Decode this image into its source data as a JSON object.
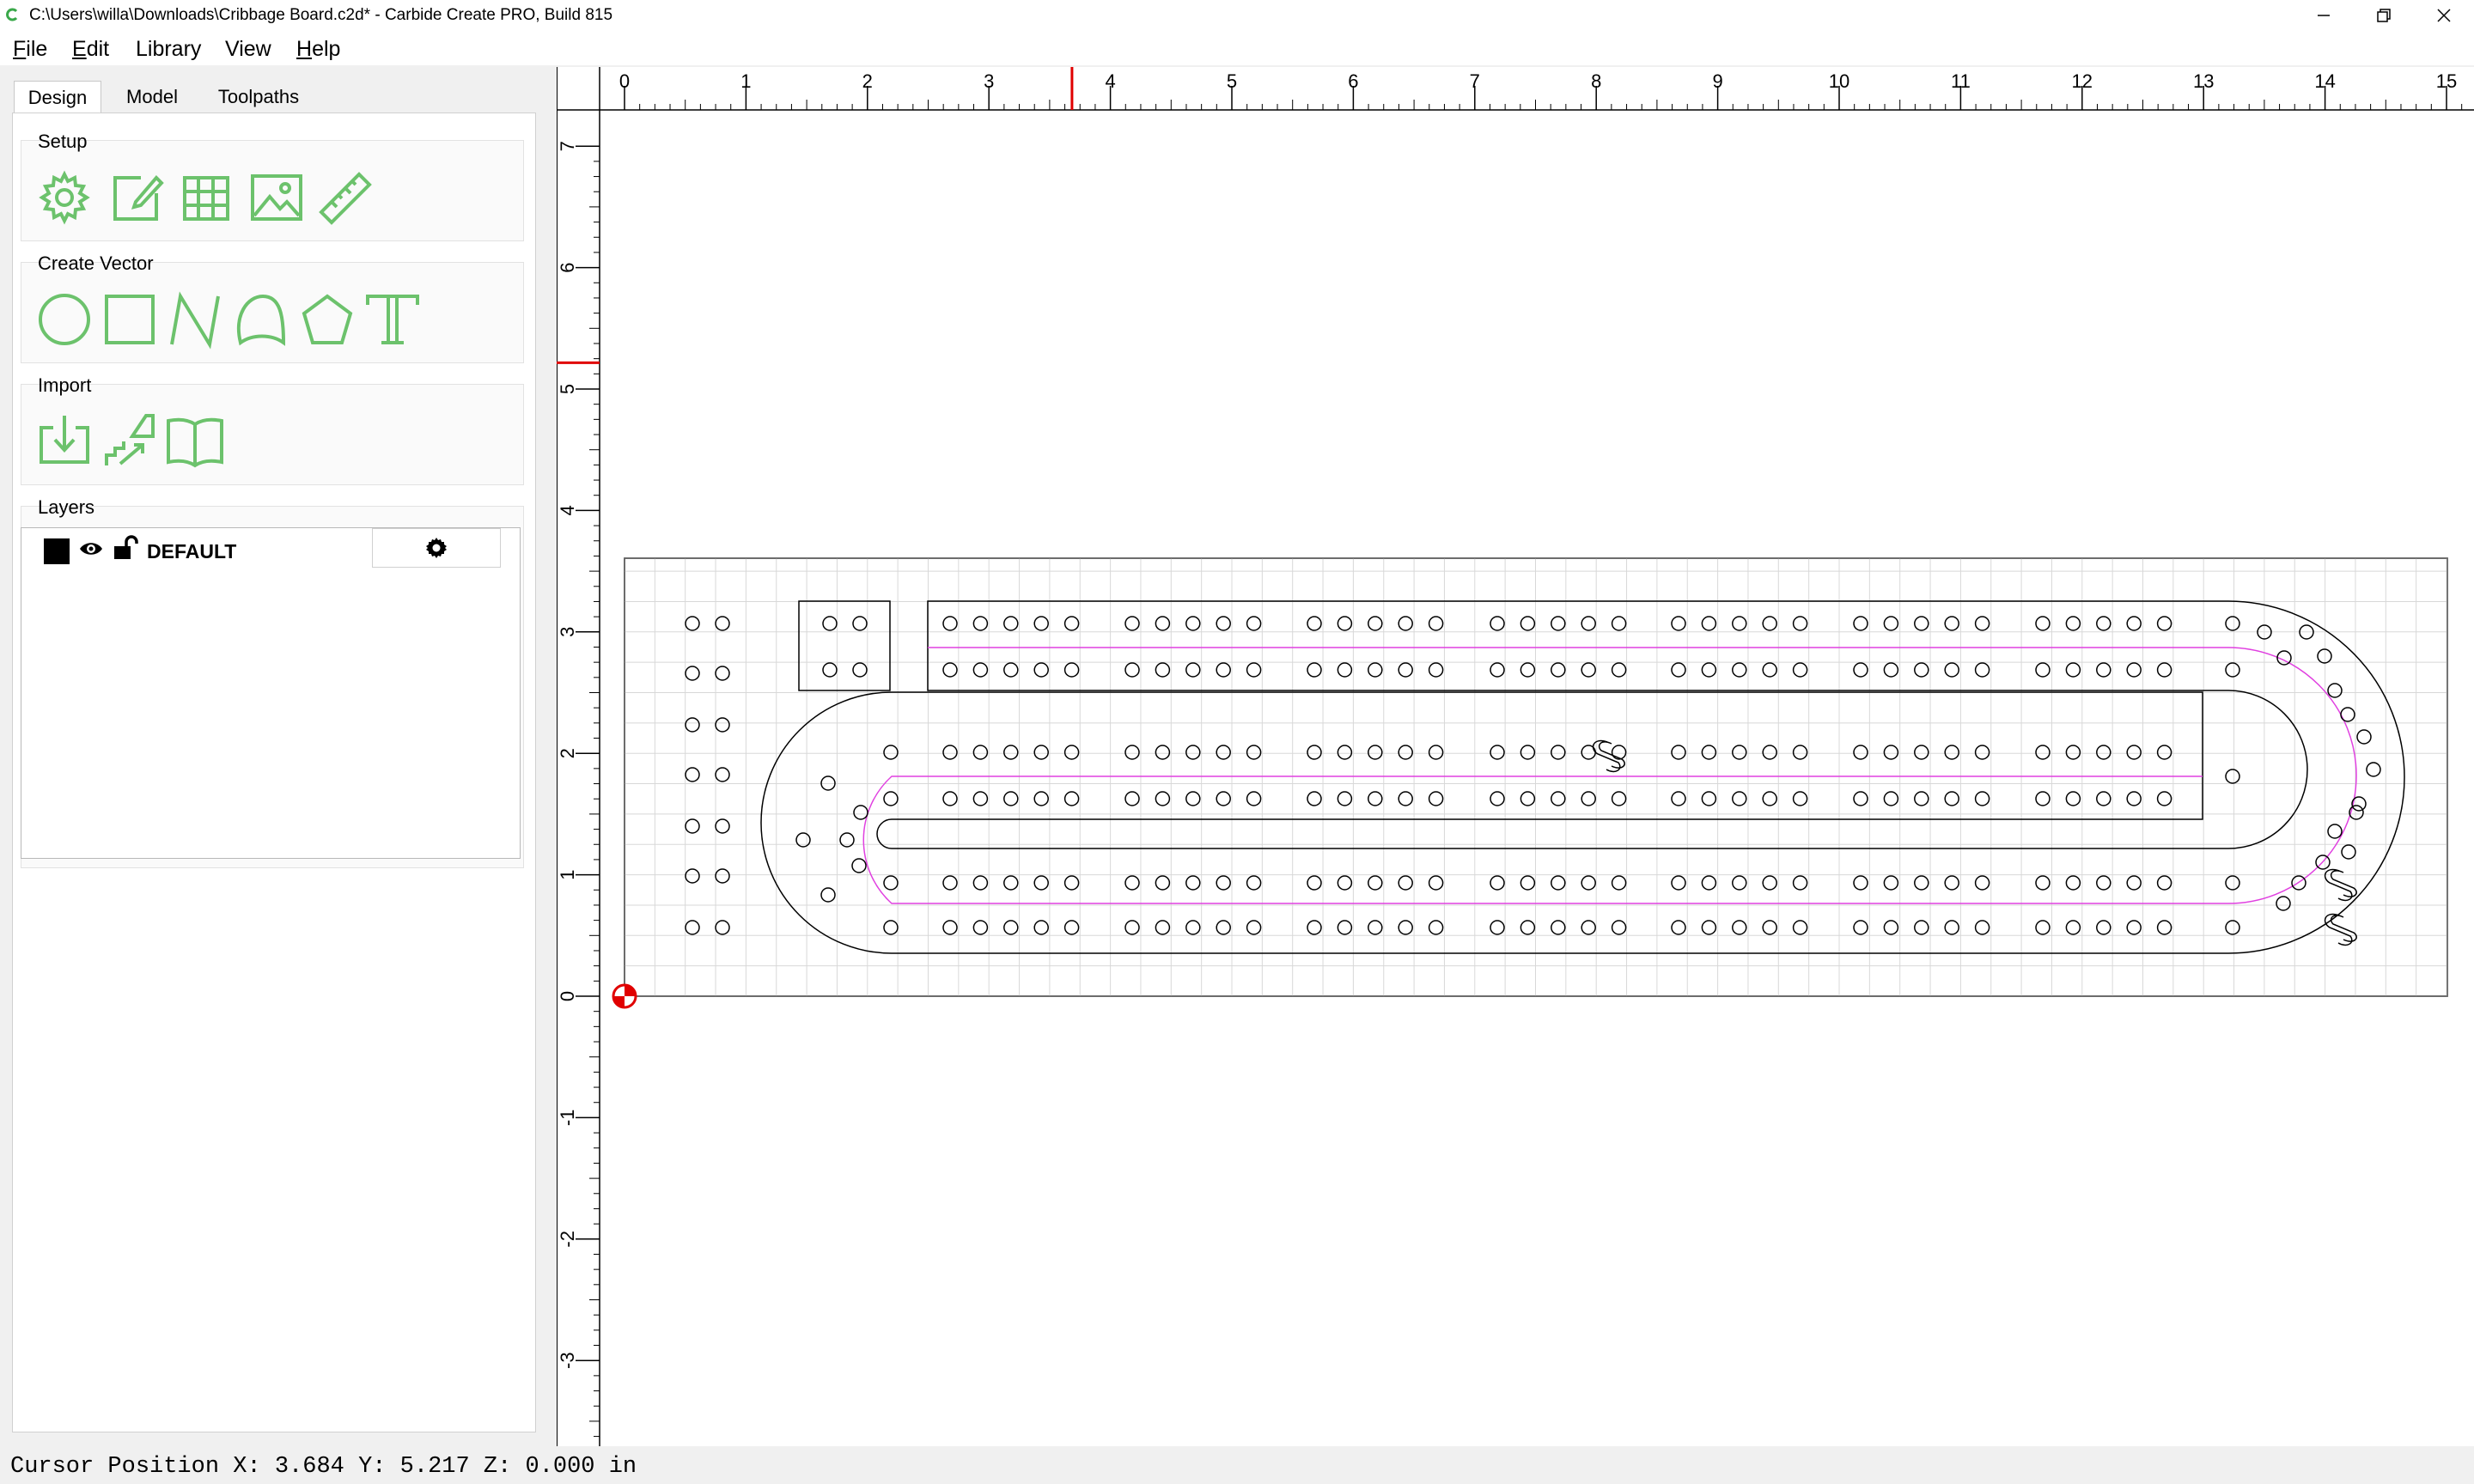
{
  "window": {
    "title": "C:\\Users\\willa\\Downloads\\Cribbage Board.c2d* - Carbide Create PRO, Build 815",
    "app_icon": "carbide-c-icon",
    "controls": [
      "minimize-icon",
      "restore-icon",
      "close-icon"
    ]
  },
  "menu": {
    "items": [
      {
        "label": "File",
        "underline": "F",
        "rest": "ile"
      },
      {
        "label": "Edit",
        "underline": "E",
        "rest": "dit"
      },
      {
        "label": "Library",
        "underline": "",
        "rest": "Library"
      },
      {
        "label": "View",
        "underline": "",
        "rest": "View"
      },
      {
        "label": "Help",
        "underline": "H",
        "rest": "elp"
      }
    ]
  },
  "tabs": [
    {
      "label": "Design",
      "active": true
    },
    {
      "label": "Model",
      "active": false
    },
    {
      "label": "Toolpaths",
      "active": false
    }
  ],
  "groups": {
    "setup": {
      "title": "Setup",
      "tools": [
        "job-setup-gear-icon",
        "edit-note-icon",
        "grid-icon",
        "image-icon",
        "ruler-icon"
      ]
    },
    "create_vector": {
      "title": "Create Vector",
      "tools": [
        "circle-icon",
        "rectangle-icon",
        "polyline-icon",
        "curve-icon",
        "polygon-icon",
        "text-icon"
      ]
    },
    "import": {
      "title": "Import",
      "tools": [
        "import-vector-icon",
        "import-stl-icon",
        "library-book-icon"
      ]
    },
    "layers": {
      "title": "Layers"
    }
  },
  "layers": [
    {
      "name": "DEFAULT",
      "color": "#000000",
      "visible": true,
      "locked": false
    }
  ],
  "ruler": {
    "x_labels": [
      "0",
      "1",
      "2",
      "3",
      "4",
      "5",
      "6",
      "7",
      "8",
      "9",
      "10",
      "11",
      "12",
      "13",
      "14",
      "15"
    ],
    "y_labels": [
      "7",
      "6",
      "5",
      "4",
      "3",
      "2",
      "1",
      "0",
      "-1",
      "-2",
      "-3"
    ]
  },
  "cursor": {
    "x": 3.684,
    "y": 5.217
  },
  "status": {
    "text": "Cursor Position X: 3.684 Y: 5.217 Z: 0.000 in"
  },
  "colors": {
    "tool_green": "#6cc26c",
    "toolpath_magenta": "#e040e0",
    "cursor_red": "#e00000",
    "grid": "#d8d8d8"
  }
}
